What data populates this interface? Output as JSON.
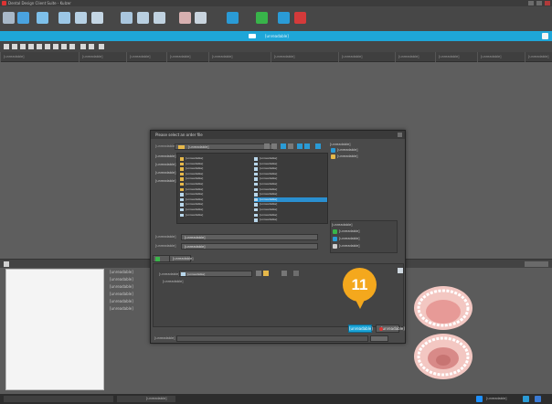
{
  "app": {
    "title": "Dental Design Client Suite - Kulzer",
    "accent": "#1ea6d8"
  },
  "main_toolbar": {
    "buttons": [
      {
        "icon": "gear-icon",
        "color": "#a8b8c8"
      },
      {
        "icon": "fish-icon",
        "color": "#4aa3e0"
      },
      {
        "icon": "star-icon",
        "color": "#7ec0ea"
      },
      {
        "icon": "monitor-icon",
        "color": "#9cc7e6"
      },
      {
        "icon": "screen-icon",
        "color": "#b6d0e4"
      },
      {
        "icon": "window-icon",
        "color": "#c4d6e4"
      },
      {
        "icon": "grid-icon",
        "color": "#a9c6de"
      },
      {
        "icon": "layout-icon",
        "color": "#b9cfe0"
      },
      {
        "icon": "panel-icon",
        "color": "#c0d2e0"
      },
      {
        "icon": "image-icon",
        "color": "#d7b0b0"
      },
      {
        "icon": "print-icon",
        "color": "#c9d4de"
      },
      {
        "icon": "arrow-icon",
        "color": "#2a9bd6"
      },
      {
        "icon": "green-flag-icon",
        "color": "#38b44a"
      },
      {
        "icon": "upload-icon",
        "color": "#2a9bd6"
      },
      {
        "icon": "stop-icon",
        "color": "#d43a3a"
      }
    ]
  },
  "banner": {
    "text": "[unreadable]"
  },
  "columns": {
    "headers": [
      "[unreadable]",
      "[unreadable]",
      "[unreadable]",
      "[unreadable]",
      "[unreadable]",
      "[unreadable]",
      "[unreadable]",
      "[unreadable]",
      "[unreadable]",
      "[unreadable]",
      "[unreadable]"
    ]
  },
  "properties": {
    "items": [
      "[unreadable]",
      "[unreadable]",
      "[unreadable]",
      "[unreadable]",
      "[unreadable]",
      "[unreadable]"
    ]
  },
  "dialog": {
    "title": "Please select an order file",
    "select_label": "[unreadable]",
    "folder": "[unreadable]",
    "places": [
      "[unreadable]",
      "[unreadable]",
      "[unreadable]",
      "[unreadable]"
    ],
    "files_col1": [
      {
        "name": "[unreadable]",
        "kind": "folder"
      },
      {
        "name": "[unreadable]",
        "kind": "folder"
      },
      {
        "name": "[unreadable]",
        "kind": "folder"
      },
      {
        "name": "[unreadable]",
        "kind": "folder"
      },
      {
        "name": "[unreadable]",
        "kind": "folder"
      },
      {
        "name": "[unreadable]",
        "kind": "folder"
      },
      {
        "name": "[unreadable]",
        "kind": "folder"
      },
      {
        "name": "[unreadable]",
        "kind": "doc"
      },
      {
        "name": "[unreadable]",
        "kind": "doc"
      },
      {
        "name": "[unreadable]",
        "kind": "doc"
      },
      {
        "name": "[unreadable]",
        "kind": "doc"
      },
      {
        "name": "[unreadable]",
        "kind": "doc"
      }
    ],
    "files_col2": [
      {
        "name": "[unreadable]",
        "kind": "doc"
      },
      {
        "name": "[unreadable]",
        "kind": "doc"
      },
      {
        "name": "[unreadable]",
        "kind": "doc"
      },
      {
        "name": "[unreadable]",
        "kind": "doc"
      },
      {
        "name": "[unreadable]",
        "kind": "doc"
      },
      {
        "name": "[unreadable]",
        "kind": "doc"
      },
      {
        "name": "[unreadable]",
        "kind": "doc"
      },
      {
        "name": "[unreadable]",
        "kind": "doc"
      },
      {
        "name": "[unreadable]",
        "kind": "doc",
        "selected": true
      },
      {
        "name": "[unreadable]",
        "kind": "doc"
      },
      {
        "name": "[unreadable]",
        "kind": "doc"
      },
      {
        "name": "[unreadable]",
        "kind": "doc"
      },
      {
        "name": "[unreadable]",
        "kind": "doc"
      }
    ],
    "right_panel": {
      "header1": "[unreadable]",
      "items1": [
        "[unreadable]",
        "[unreadable]"
      ],
      "header2": "[unreadable]",
      "items2": [
        "[unreadable]",
        "[unreadable]",
        "[unreadable]"
      ]
    },
    "fields": {
      "filename_label": "[unreadable]",
      "filename_value": "[unreadable]",
      "filetype_label": "[unreadable]",
      "filetype_value": "[unreadable]"
    },
    "tab_label": "[unreadable]",
    "order_label": "[unreadable]",
    "order_value": "[unreadable]",
    "order_note": "[unreadable]",
    "ok_label": "[unreadable]",
    "cancel_label": "[unreadable]",
    "path_label": "[unreadable]"
  },
  "status": {
    "left": "[unreadable]",
    "right": "[unreadable]"
  },
  "callout": {
    "number": "11",
    "color": "#f4a81d"
  }
}
